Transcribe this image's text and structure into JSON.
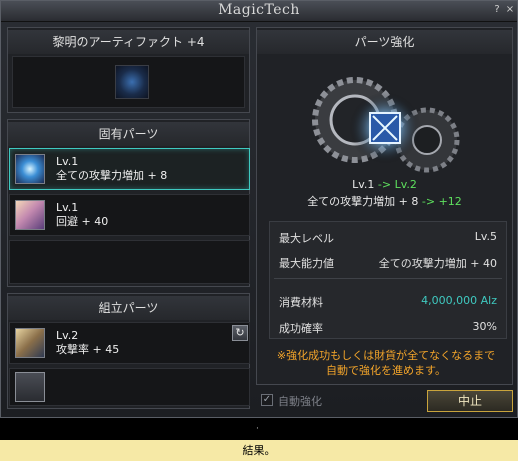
{
  "window": {
    "title": "MagicTech",
    "help_label": "?",
    "close_label": "×"
  },
  "artifact": {
    "header": "黎明のアーティファクト +4"
  },
  "unique_parts": {
    "header": "固有パーツ",
    "items": [
      {
        "level": "Lv.1",
        "stat": "全ての攻撃力増加 + 8"
      },
      {
        "level": "Lv.1",
        "stat": "回避 + 40"
      }
    ]
  },
  "assembly_parts": {
    "header": "組立パーツ",
    "items": [
      {
        "level": "Lv.2",
        "stat": "攻撃率 + 45"
      }
    ]
  },
  "enhance": {
    "header": "パーツ強化",
    "level_from": "Lv.1",
    "arrow": "->",
    "level_to": "Lv.2",
    "stat_name": "全ての攻撃力増加 + 8",
    "stat_to": "+12",
    "rows": [
      {
        "label": "最大レベル",
        "value": "Lv.5"
      },
      {
        "label": "最大能力値",
        "value": "全ての攻撃力増加 + 40"
      },
      {
        "label": "消費材料",
        "value": "4,000,000 Alz"
      },
      {
        "label": "成功確率",
        "value": "30%"
      }
    ],
    "note_line1": "※強化成功もしくは財貨が全てなくなるまで",
    "note_line2": "自動で強化を進めます。",
    "auto_label": "自動強化",
    "stop_label": "中止"
  },
  "bottom": {
    "dot": "·",
    "result": "結果。"
  },
  "colors": {
    "accent_cyan": "#3fc9c0",
    "green": "#5ee05e",
    "orange": "#f2a42a",
    "gold_border": "#c9a43c"
  },
  "icons": {
    "refresh": "refresh-icon",
    "check": "check-icon"
  }
}
